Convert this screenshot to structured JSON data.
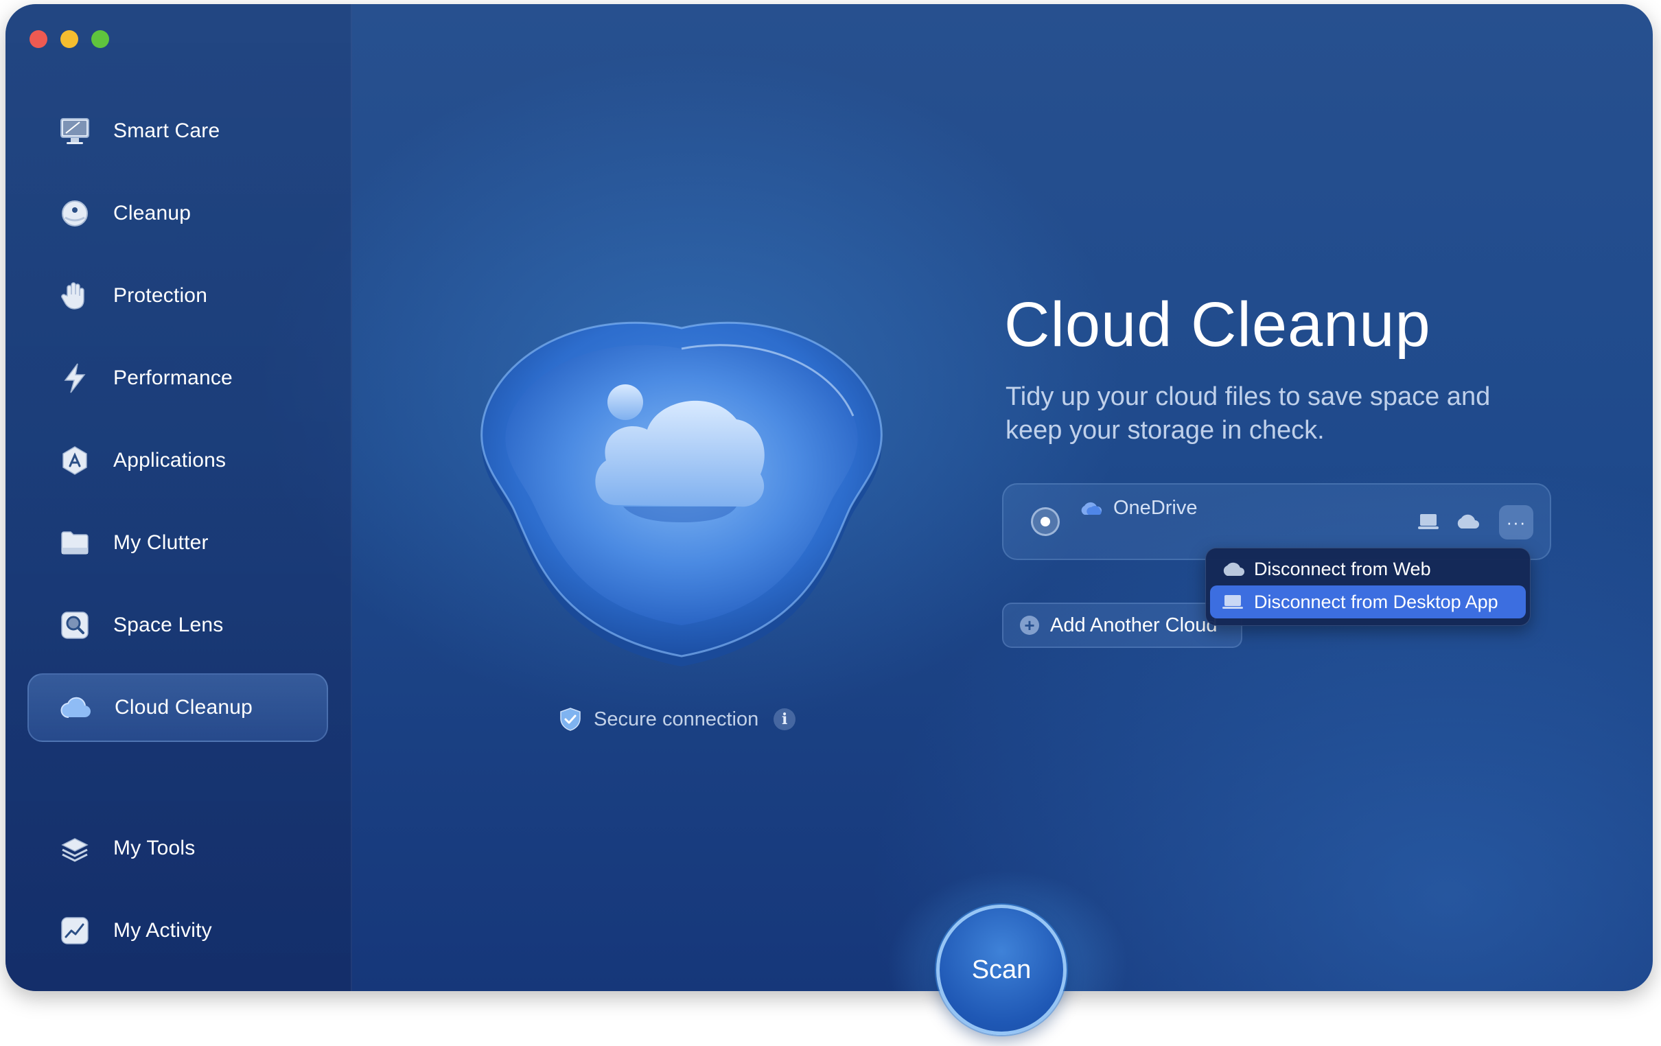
{
  "window": {
    "traffic_lights": [
      "close",
      "minimize",
      "zoom"
    ]
  },
  "sidebar": {
    "items": [
      {
        "label": "Smart Care",
        "icon": "imac-icon"
      },
      {
        "label": "Cleanup",
        "icon": "cleanup-disc-icon"
      },
      {
        "label": "Protection",
        "icon": "hand-icon"
      },
      {
        "label": "Performance",
        "icon": "lightning-icon"
      },
      {
        "label": "Applications",
        "icon": "app-store-icon"
      },
      {
        "label": "My Clutter",
        "icon": "folder-icon"
      },
      {
        "label": "Space Lens",
        "icon": "lens-icon"
      },
      {
        "label": "Cloud Cleanup",
        "icon": "cloud-icon",
        "active": true
      },
      {
        "label": "My Tools",
        "icon": "stack-icon"
      },
      {
        "label": "My Activity",
        "icon": "activity-chart-icon"
      }
    ]
  },
  "main": {
    "title": "Cloud Cleanup",
    "subtitle": "Tidy up your cloud files to save space and keep your storage in check.",
    "secure_connection": "Secure connection",
    "info_glyph": "i",
    "cloud_account": {
      "name": "OneDrive",
      "more_glyph": "···"
    },
    "add_cloud": "Add Another Cloud",
    "context_menu": {
      "items": [
        {
          "label": "Disconnect from Web",
          "icon": "cloud-icon",
          "highlighted": false
        },
        {
          "label": "Disconnect from Desktop App",
          "icon": "laptop-icon",
          "highlighted": true
        }
      ]
    },
    "scan_button": "Scan"
  },
  "colors": {
    "accent": "#3c6ee0",
    "background": "#1f4a8c",
    "traffic_red": "#ee5a52",
    "traffic_yellow": "#f5bd2f",
    "traffic_green": "#5fc43d"
  }
}
